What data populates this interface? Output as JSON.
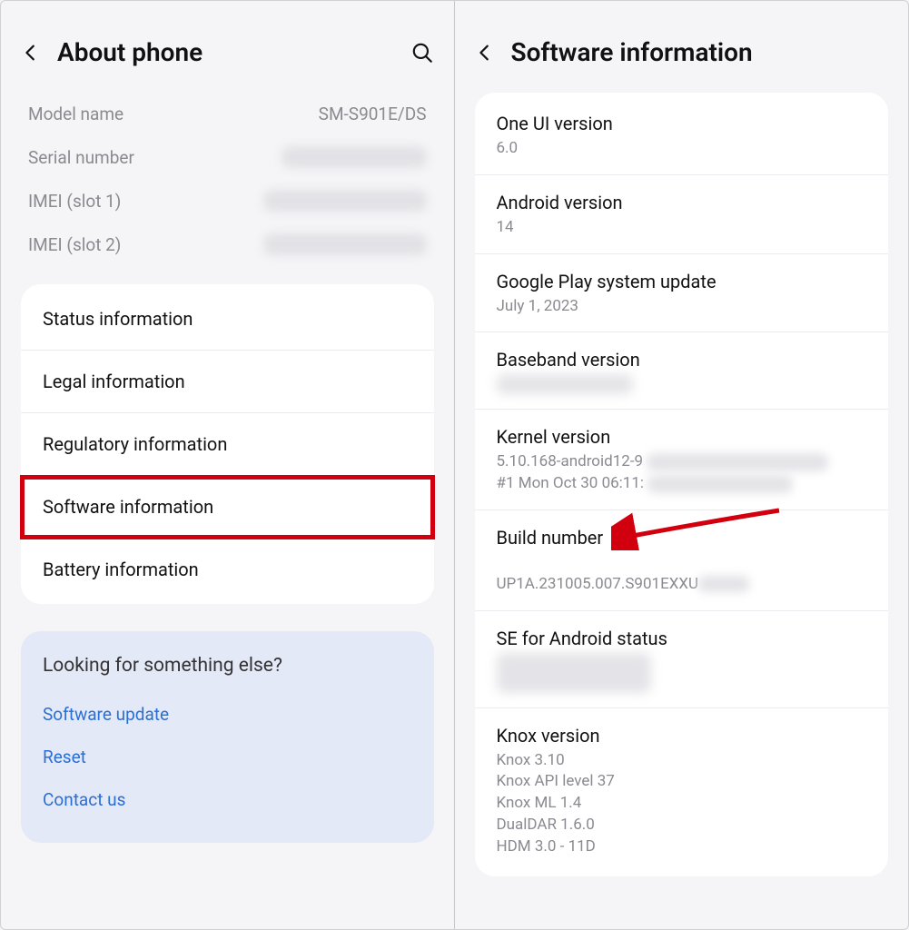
{
  "left": {
    "title": "About phone",
    "rows": {
      "model_label": "Model name",
      "model_value": "SM-S901E/DS",
      "serial_label": "Serial number",
      "imei1_label": "IMEI (slot 1)",
      "imei2_label": "IMEI (slot 2)"
    },
    "card_items": [
      "Status information",
      "Legal information",
      "Regulatory information",
      "Software information",
      "Battery information"
    ],
    "suggest": {
      "title": "Looking for something else?",
      "links": [
        "Software update",
        "Reset",
        "Contact us"
      ]
    }
  },
  "right": {
    "title": "Software information",
    "items": {
      "oneui_label": "One UI version",
      "oneui_value": "6.0",
      "android_label": "Android version",
      "android_value": "14",
      "play_label": "Google Play system update",
      "play_value": "July 1, 2023",
      "baseband_label": "Baseband version",
      "kernel_label": "Kernel version",
      "kernel_value1": "5.10.168-android12-9",
      "kernel_value2": "#1 Mon Oct 30 06:11:",
      "build_label": "Build number",
      "build_value": "UP1A.231005.007.S901EXXU",
      "se_label": "SE for Android status",
      "knox_label": "Knox version",
      "knox_value": "Knox 3.10\nKnox API level 37\nKnox ML 1.4\nDualDAR 1.6.0\nHDM 3.0 - 11D"
    }
  }
}
